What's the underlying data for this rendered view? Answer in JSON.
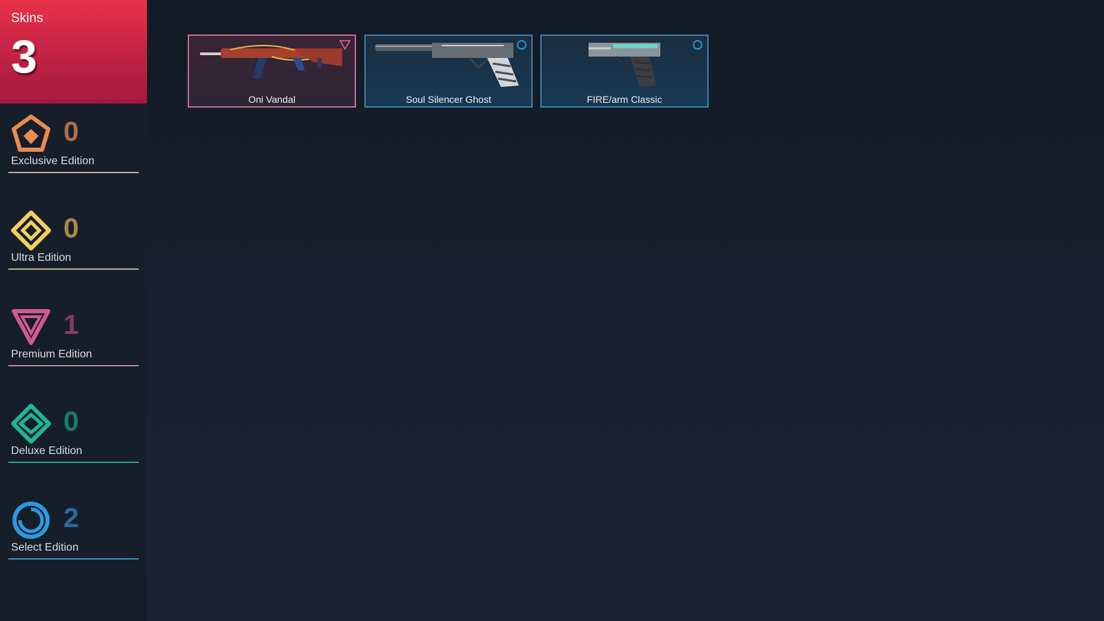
{
  "sidebar": {
    "total": {
      "label": "Skins",
      "count": "3"
    },
    "tiers": [
      {
        "name": "Exclusive Edition",
        "count": "0",
        "icon": "exclusive-edition-icon",
        "color": "#e98b52",
        "count_color": "#b06e4a"
      },
      {
        "name": "Ultra Edition",
        "count": "0",
        "icon": "ultra-edition-icon",
        "color": "#f2d060",
        "count_color": "#a88a4c"
      },
      {
        "name": "Premium Edition",
        "count": "1",
        "icon": "premium-edition-icon",
        "color": "#d05a92",
        "count_color": "#8a3a60"
      },
      {
        "name": "Deluxe Edition",
        "count": "0",
        "icon": "deluxe-edition-icon",
        "color": "#1fb59a",
        "count_color": "#1a7d6c"
      },
      {
        "name": "Select Edition",
        "count": "2",
        "icon": "select-edition-icon",
        "color": "#2a9be0",
        "count_color": "#2a6a9a"
      }
    ]
  },
  "cards": [
    {
      "name": "Oni Vandal",
      "tier": "premium",
      "icon": "premium-edition-icon"
    },
    {
      "name": "Soul Silencer Ghost",
      "tier": "select",
      "icon": "select-edition-icon"
    },
    {
      "name": "FIRE/arm Classic",
      "tier": "select",
      "icon": "select-edition-icon"
    }
  ]
}
